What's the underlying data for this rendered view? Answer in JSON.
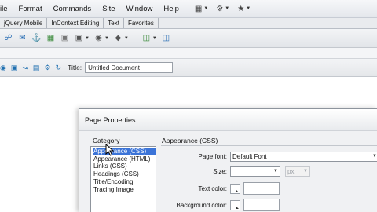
{
  "menubar": {
    "items": [
      "ile",
      "Format",
      "Commands",
      "Site",
      "Window",
      "Help"
    ],
    "icons": [
      "layout-icon",
      "gear-icon",
      "extensions-icon"
    ]
  },
  "tabs": [
    "jQuery Mobile",
    "InContext Editing",
    "Text",
    "Favorites"
  ],
  "document_toolbar": {
    "title_label": "Title:",
    "title_value": "Untitled Document"
  },
  "dialog": {
    "title": "Page Properties",
    "category_label": "Category",
    "categories": [
      "Appearance (CSS)",
      "Appearance (HTML)",
      "Links (CSS)",
      "Headings (CSS)",
      "Title/Encoding",
      "Tracing Image"
    ],
    "selected_index": 0,
    "pane_title": "Appearance (CSS)",
    "page_font_label": "Page font:",
    "page_font_value": "Default Font",
    "size_label": "Size:",
    "size_value": "",
    "size_unit": "px",
    "text_color_label": "Text color:",
    "background_color_label": "Background color:"
  },
  "colors": {
    "selection": "#3b74d8",
    "dialog_bg": "#f0f1f3"
  }
}
